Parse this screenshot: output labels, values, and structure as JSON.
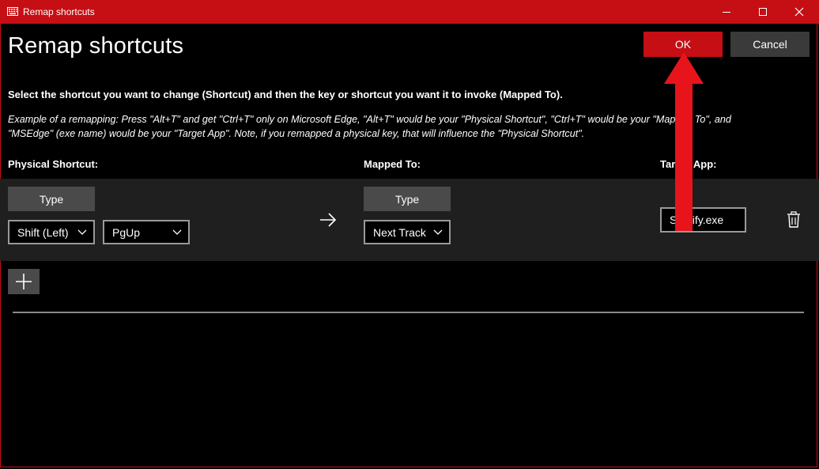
{
  "window": {
    "title": "Remap shortcuts",
    "accent_color": "#c50f14"
  },
  "page": {
    "heading": "Remap shortcuts",
    "ok_label": "OK",
    "cancel_label": "Cancel",
    "instructions": "Select the shortcut you want to change (Shortcut) and then the key or shortcut you want it to invoke (Mapped To).",
    "example_line1": "Example of a remapping: Press \"Alt+T\" and get \"Ctrl+T\" only on Microsoft Edge, \"Alt+T\" would be your \"Physical Shortcut\", \"Ctrl+T\" would be your \"Mapped To\", and",
    "example_line2": "\"MSEdge\" (exe name) would be your \"Target App\". Note, if you remapped a physical key, that will influence the \"Physical Shortcut\"."
  },
  "columns": {
    "physical": "Physical Shortcut:",
    "mapped": "Mapped To:",
    "target": "Target App:"
  },
  "row": {
    "physical_type_label": "Type",
    "physical_keys": [
      "Shift (Left)",
      "PgUp"
    ],
    "mapped_type_label": "Type",
    "mapped_key": "Next Track",
    "target_app": "Spotify.exe"
  },
  "icons": {
    "app": "keyboard-icon",
    "minimize": "minimize-icon",
    "maximize": "maximize-icon",
    "close": "close-icon",
    "arrow": "arrow-right-icon",
    "chevron": "chevron-down-icon",
    "delete": "trash-icon",
    "add": "plus-icon",
    "annotation": "red-arrow-up"
  },
  "annotation_color": "#e8141c"
}
